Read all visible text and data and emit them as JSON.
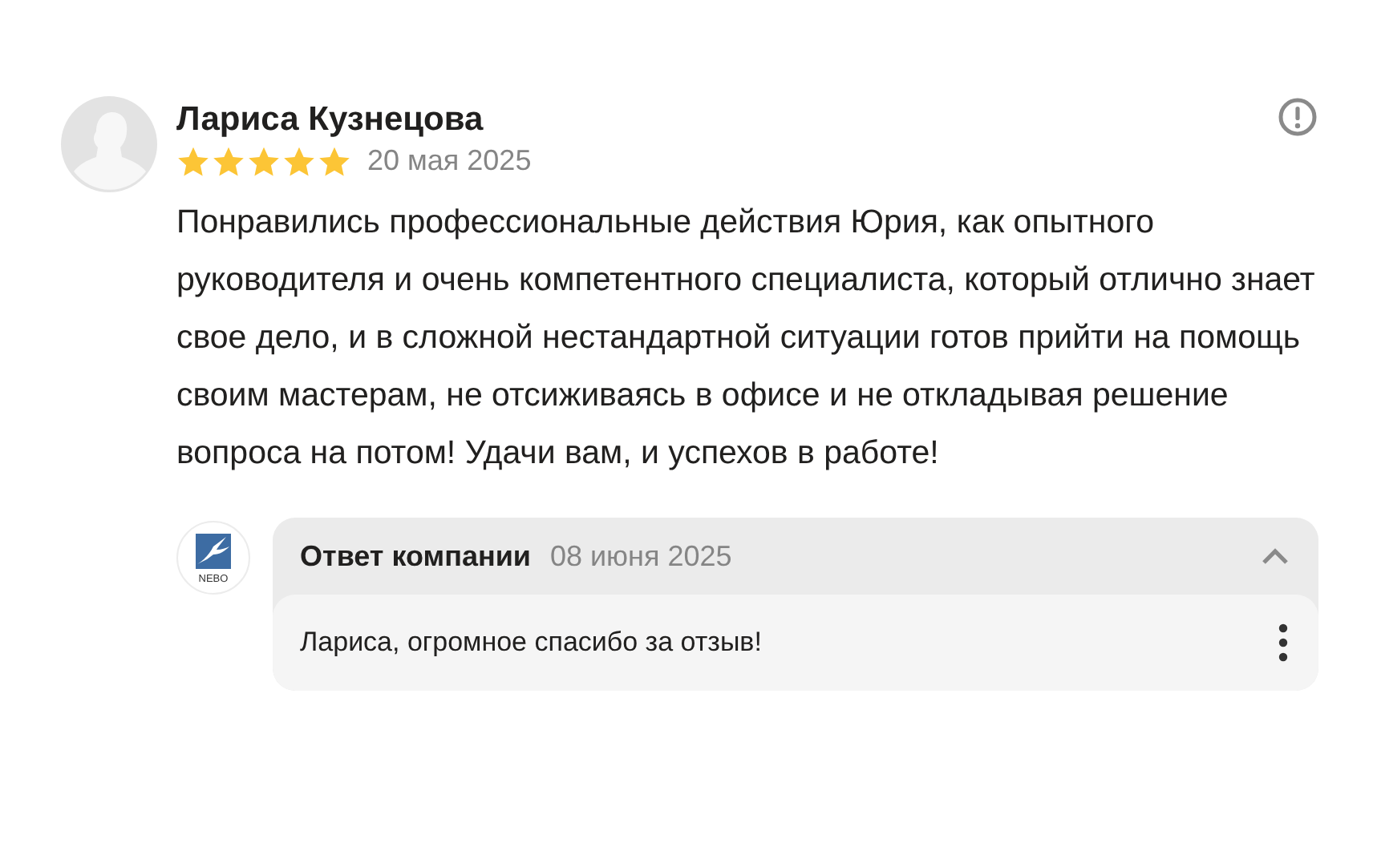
{
  "review": {
    "author": "Лариса Кузнецова",
    "stars": 5,
    "date": "20 мая 2025",
    "text": "Понравились профессиональные действия Юрия, как опытного руководителя и очень компетентного специалиста, который отлично знает свое дело, и в сложной нестандартной ситуации готов прийти на помощь своим мастерам, не отсиживаясь в офисе и не откладывая решение вопроса на потом! Удачи вам, и успехов в работе!"
  },
  "reply": {
    "logo_text": "NEBO",
    "title": "Ответ компании",
    "date": "08 июня 2025",
    "expanded": true,
    "text": "Лариса, огромное спасибо за отзыв!"
  }
}
